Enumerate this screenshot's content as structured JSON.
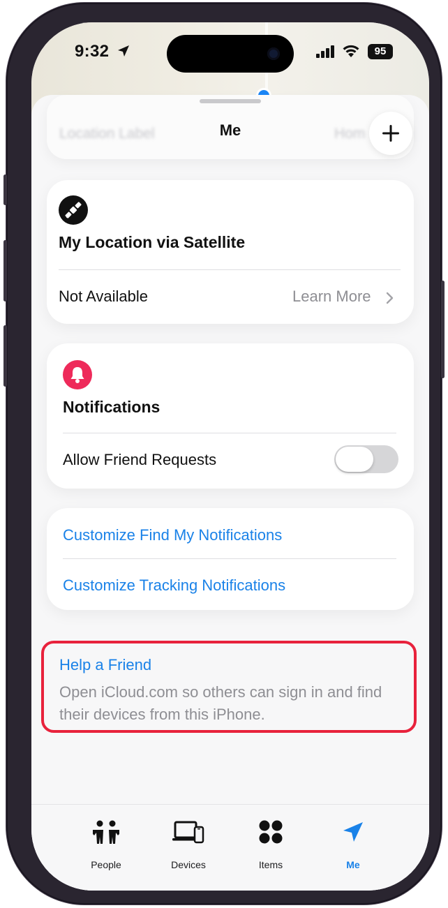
{
  "status_bar": {
    "time": "9:32",
    "battery": "95"
  },
  "header": {
    "title": "Me",
    "ghost_left": "Location Label",
    "ghost_right": "Hom"
  },
  "satellite_card": {
    "icon": "satellite-icon",
    "title": "My Location via Satellite",
    "status": "Not Available",
    "learn_more": "Learn More"
  },
  "notifications_card": {
    "icon": "bell-icon",
    "title": "Notifications",
    "allow_friend_requests": "Allow Friend Requests",
    "toggle_on": false
  },
  "customize_card": {
    "find_my": "Customize Find My Notifications",
    "tracking": "Customize Tracking Notifications"
  },
  "help_friend": {
    "title": "Help a Friend",
    "description": "Open iCloud.com so others can sign in and find their devices from this iPhone."
  },
  "tabs": [
    {
      "label": "People",
      "icon": "people-icon",
      "active": false
    },
    {
      "label": "Devices",
      "icon": "devices-icon",
      "active": false
    },
    {
      "label": "Items",
      "icon": "items-icon",
      "active": false
    },
    {
      "label": "Me",
      "icon": "location-arrow-icon",
      "active": true
    }
  ],
  "colors": {
    "accent": "#1a82e8",
    "highlight_border": "#e8223c",
    "bell_badge": "#ee2a5a"
  }
}
